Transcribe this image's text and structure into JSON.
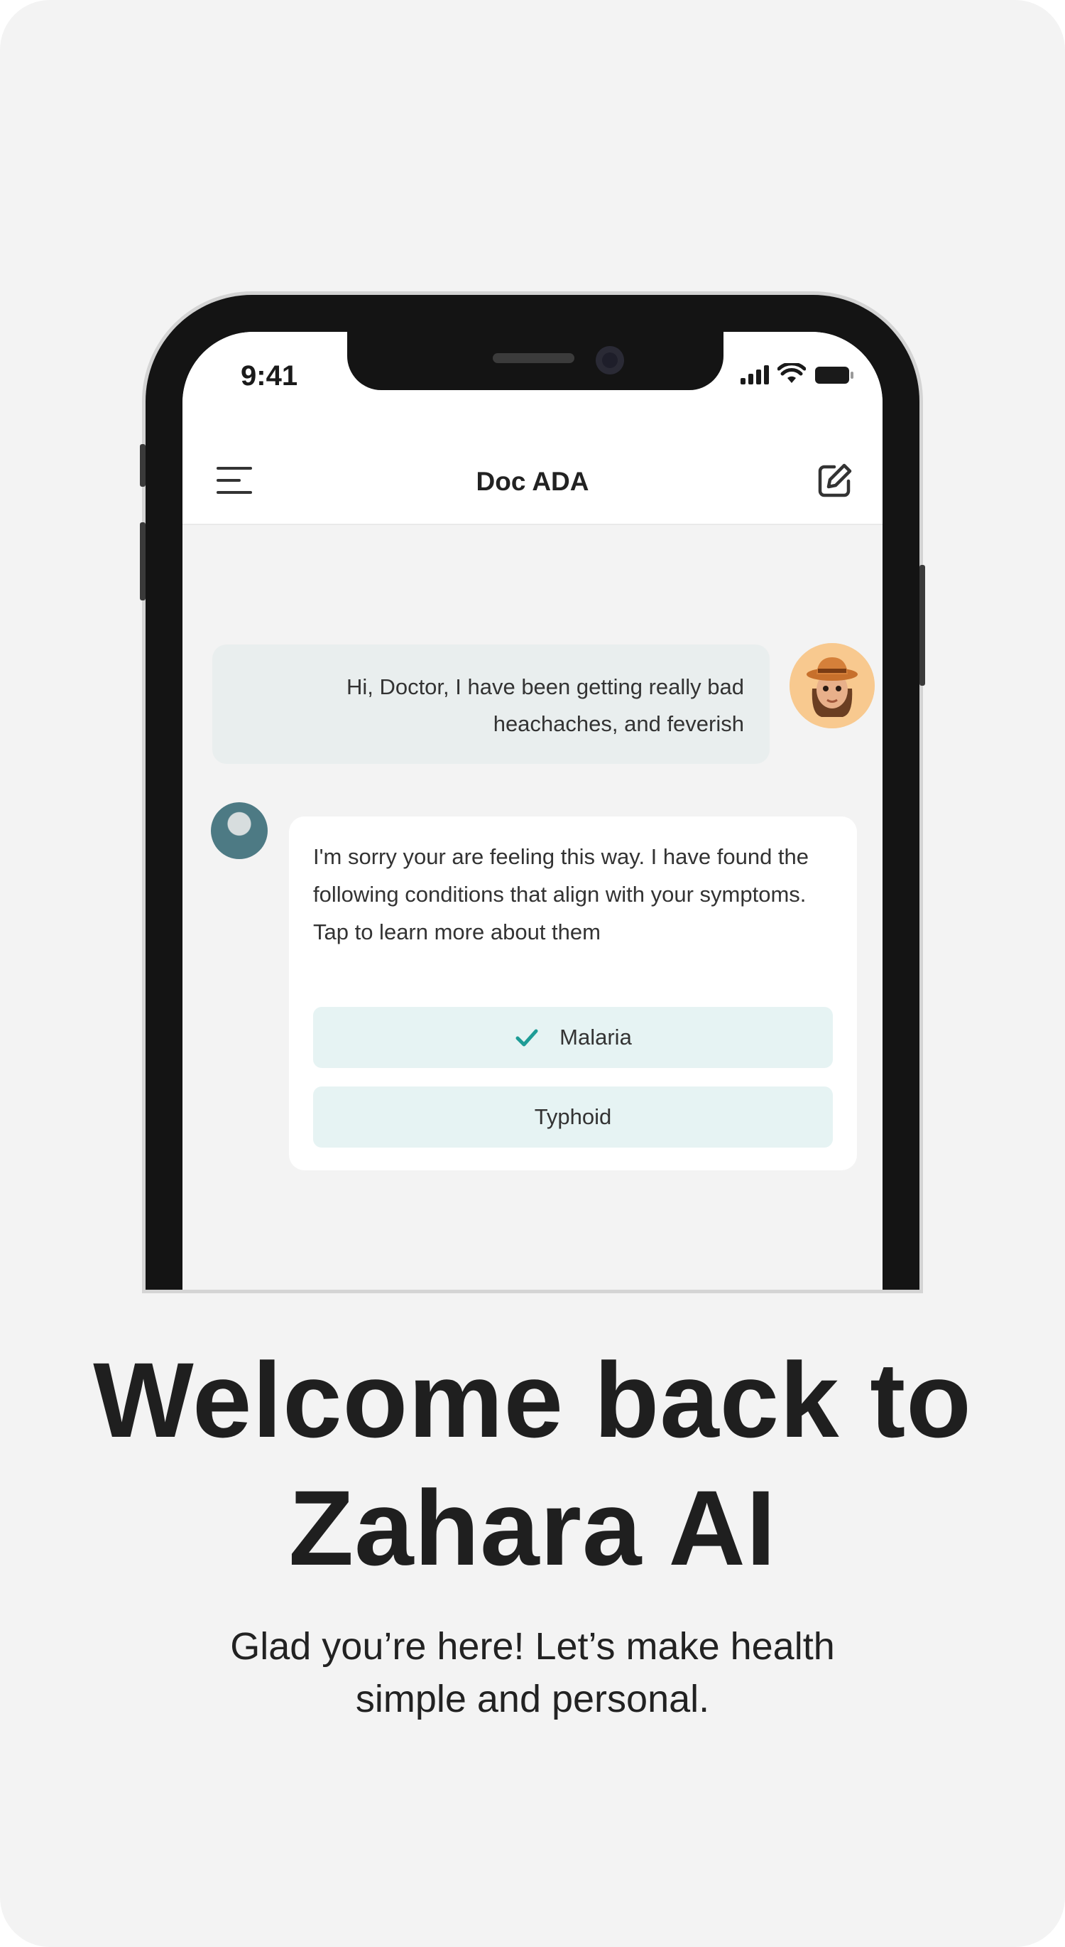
{
  "phone": {
    "time": "9:41",
    "header_title": "Doc ADA"
  },
  "chat": {
    "user_message_line1": "Hi, Doctor, I have been getting really bad",
    "user_message_line2": "heachaches, and feverish",
    "bot_message": "I'm sorry your are feeling this way. I have found the following conditions that align with your symptoms. Tap to learn more about them",
    "conditions": [
      {
        "label": "Malaria",
        "selected": true
      },
      {
        "label": "Typhoid",
        "selected": false
      }
    ],
    "accent_color": "#1e9c96"
  },
  "welcome": {
    "title_line1": "Welcome back to",
    "title_line2": "Zahara AI",
    "subtitle_line1": "Glad you’re here! Let’s make health",
    "subtitle_line2": "simple and personal."
  },
  "icons": [
    "menu-icon",
    "edit-icon",
    "check-icon",
    "signal-icon",
    "wifi-icon",
    "battery-icon"
  ]
}
